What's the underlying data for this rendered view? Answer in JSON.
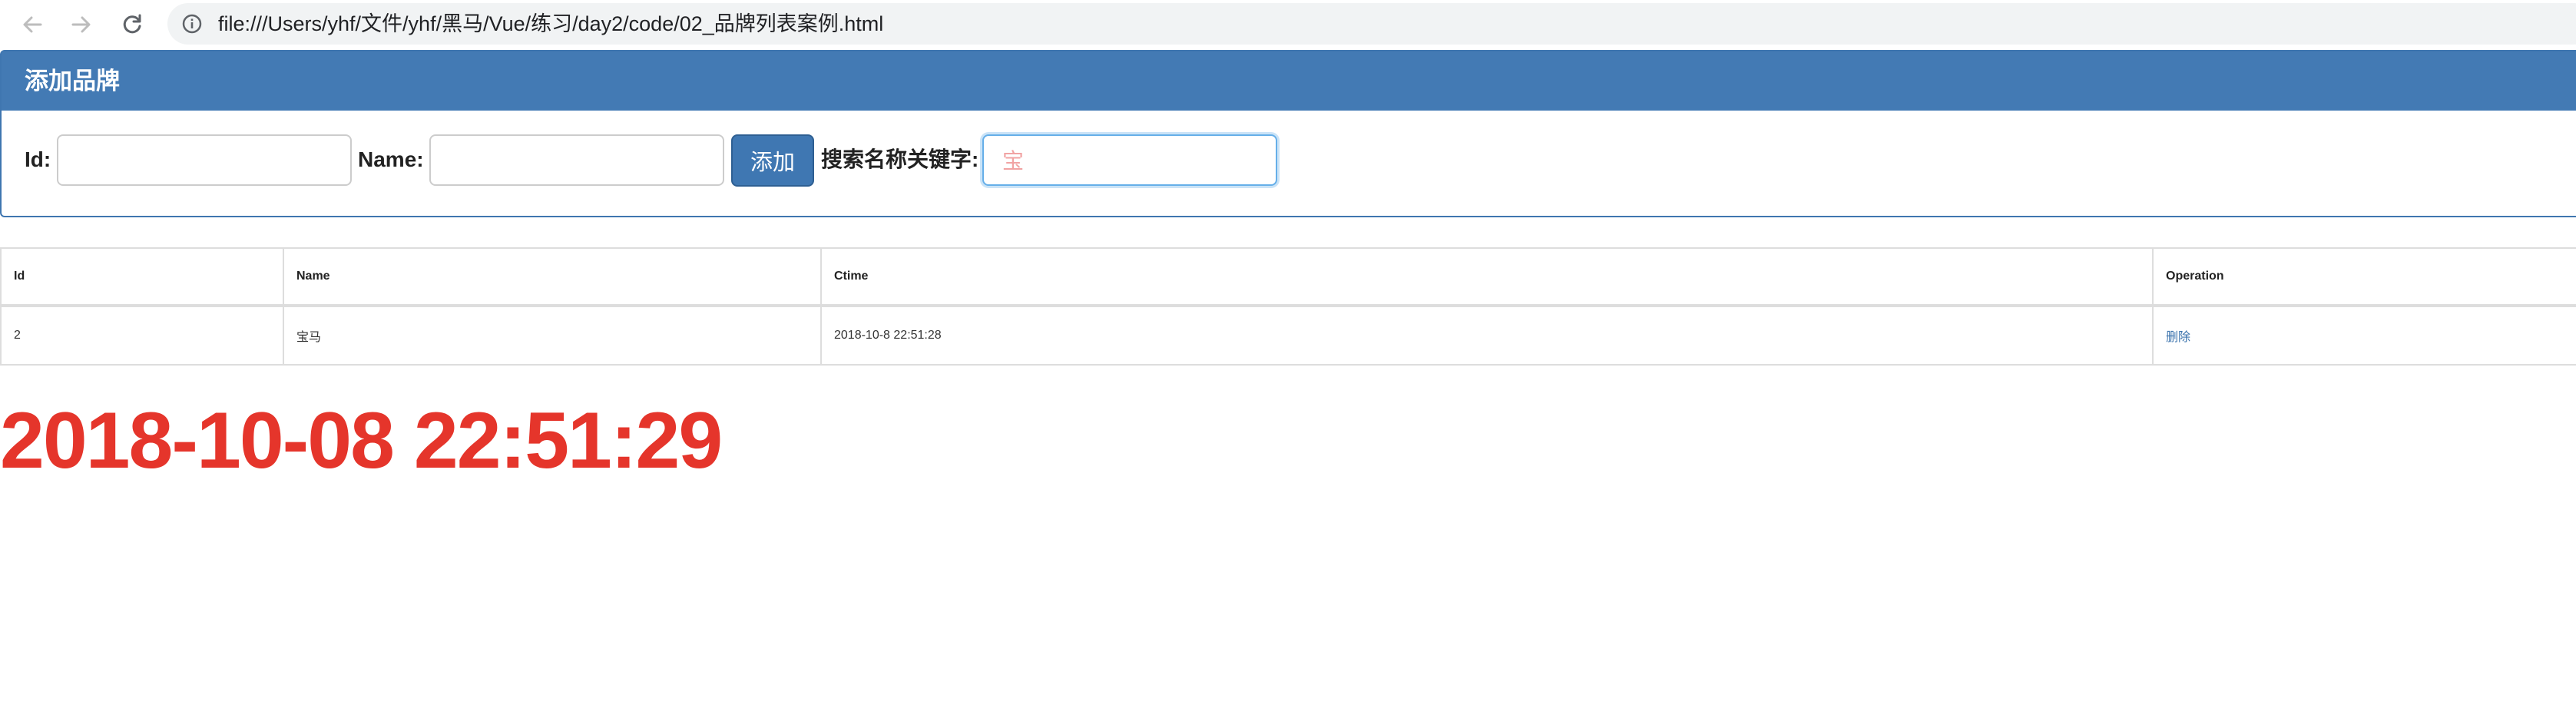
{
  "browser": {
    "url": "file:///Users/yhf/文件/yhf/黑马/Vue/练习/day2/code/02_品牌列表案例.html"
  },
  "panel": {
    "title": "添加品牌",
    "id_label": "Id:",
    "id_value": "",
    "name_label": "Name:",
    "name_value": "",
    "add_button": "添加",
    "search_label": "搜索名称关键字:",
    "search_value": "宝"
  },
  "table": {
    "headers": [
      "Id",
      "Name",
      "Ctime",
      "Operation"
    ],
    "rows": [
      {
        "id": "2",
        "name": "宝马",
        "ctime": "2018-10-8 22:51:28",
        "operation": "删除"
      }
    ]
  },
  "clock": "2018-10-08 22:51:29",
  "colors": {
    "panel_heading": "#437ab4",
    "button": "#3f77b2",
    "link": "#3b73ad",
    "clock": "#e5352b"
  },
  "icons": [
    "back-arrow-icon",
    "forward-arrow-icon",
    "reload-icon",
    "info-icon"
  ]
}
